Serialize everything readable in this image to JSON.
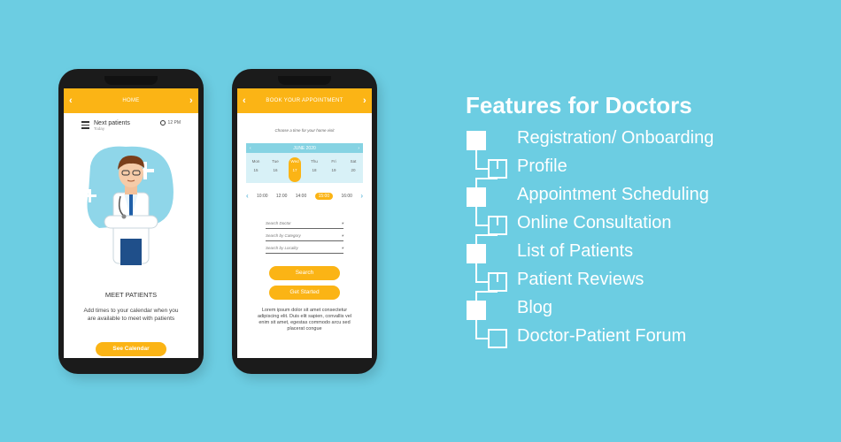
{
  "phone1": {
    "appbar_title": "HOME",
    "next_patients": "Next patients",
    "next_patients_sub": "Today",
    "time": "12 PM",
    "meet_title": "MEET PATIENTS",
    "description": "Add times to your calendar when you are available to meet with patients",
    "cta": "See Calendar"
  },
  "phone2": {
    "appbar_title": "BOOK YOUR APPOINTMENT",
    "hint": "Choose a time for your home visit",
    "calendar": {
      "month": "JUNE 2020",
      "days": [
        {
          "name": "Mon",
          "num": "15"
        },
        {
          "name": "Tue",
          "num": "16"
        },
        {
          "name": "Wed",
          "num": "17",
          "selected": true
        },
        {
          "name": "Thu",
          "num": "18"
        },
        {
          "name": "Fri",
          "num": "19"
        },
        {
          "name": "Sat",
          "num": "20"
        }
      ]
    },
    "times": [
      "10:00",
      "12:00",
      "14:00",
      "15:00",
      "16:00"
    ],
    "selected_time": "15:00",
    "dropdowns": [
      "Search Doctor",
      "Search by Category",
      "Search by Locality"
    ],
    "search_btn": "Search",
    "start_btn": "Get Started",
    "lorem": "Lorem ipsum dolor sit amet consectetur adipiscing elit. Duis elit sapien, convallis vel enim sit amet, egestas commodo arcu sed placerat congue"
  },
  "features": {
    "title": "Features for Doctors",
    "items": [
      "Registration/ Onboarding",
      "Profile",
      "Appointment Scheduling",
      "Online Consultation",
      "List of Patients",
      "Patient Reviews",
      "Blog",
      "Doctor-Patient Forum"
    ]
  },
  "colors": {
    "background": "#6ccde2",
    "accent": "#fbb415",
    "calendar_head": "#86d3e3"
  }
}
